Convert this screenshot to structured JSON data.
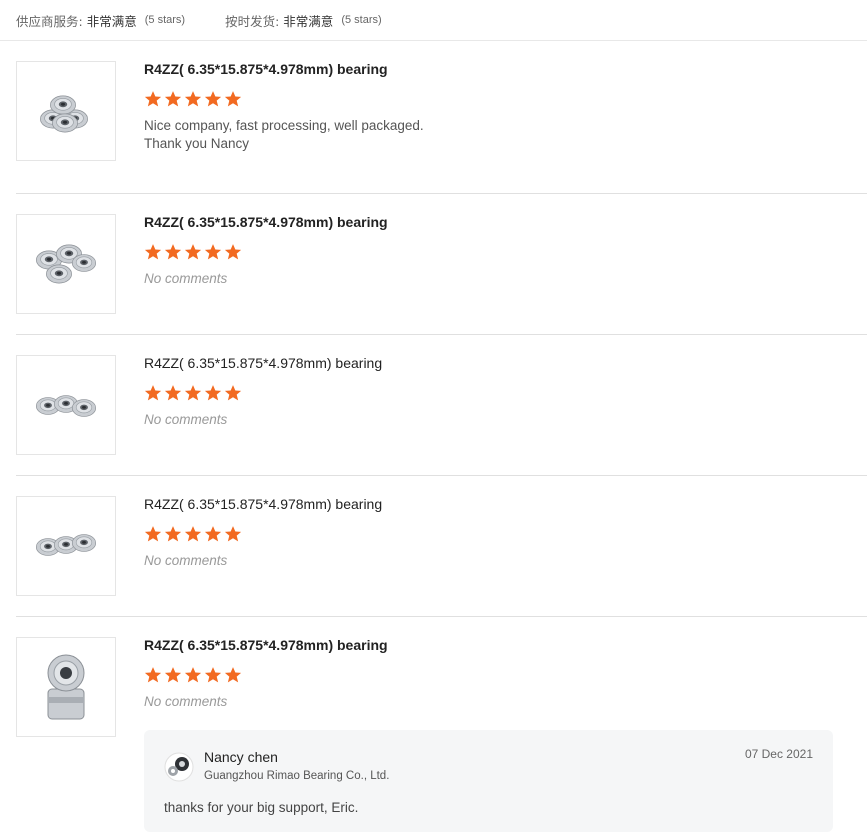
{
  "summary": {
    "supplier_service_label": "供应商服务:",
    "supplier_service_value": "非常满意",
    "supplier_service_stars": "(5 stars)",
    "on_time_label": "按时发货:",
    "on_time_value": "非常满意",
    "on_time_stars": "(5 stars)"
  },
  "reviews": [
    {
      "title": "R4ZZ( 6.35*15.875*4.978mm) bearing",
      "rating": 5,
      "comment": "Nice company, fast processing, well packaged.\nThank you Nancy",
      "image": "bearing-group-icon"
    },
    {
      "title": "R4ZZ( 6.35*15.875*4.978mm) bearing",
      "rating": 5,
      "comment": "No comments",
      "image": "bearing-group-icon"
    },
    {
      "title": "R4ZZ( 6.35*15.875*4.978mm) bearing",
      "rating": 5,
      "comment": "No comments",
      "image": "bearing-group-icon"
    },
    {
      "title": "R4ZZ( 6.35*15.875*4.978mm) bearing",
      "rating": 5,
      "comment": "No comments",
      "image": "bearing-group-icon"
    },
    {
      "title": "R4ZZ( 6.35*15.875*4.978mm) bearing",
      "rating": 5,
      "comment": "No comments",
      "image": "bearing-stack-icon"
    }
  ],
  "reply": {
    "name": "Nancy chen",
    "company": "Guangzhou Rimao Bearing Co., Ltd.",
    "date": "07 Dec 2021",
    "text": "thanks for your big support, Eric."
  },
  "colors": {
    "star": "#f26a21",
    "divider": "#e0e0e0",
    "reply_bg": "#f5f6f7"
  }
}
